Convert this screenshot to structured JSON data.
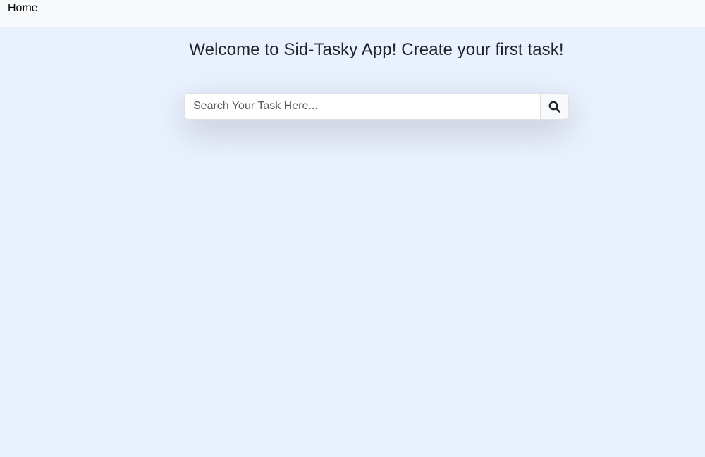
{
  "navbar": {
    "home_label": "Home"
  },
  "main": {
    "title": "Welcome to Sid-Tasky App! Create your first task!"
  },
  "search": {
    "placeholder": "Search Your Task Here...",
    "value": "",
    "button_icon": "search-icon"
  },
  "colors": {
    "page_background": "#eaf1fe",
    "navbar_background": "#f8f9fa",
    "title_text": "#212529"
  }
}
